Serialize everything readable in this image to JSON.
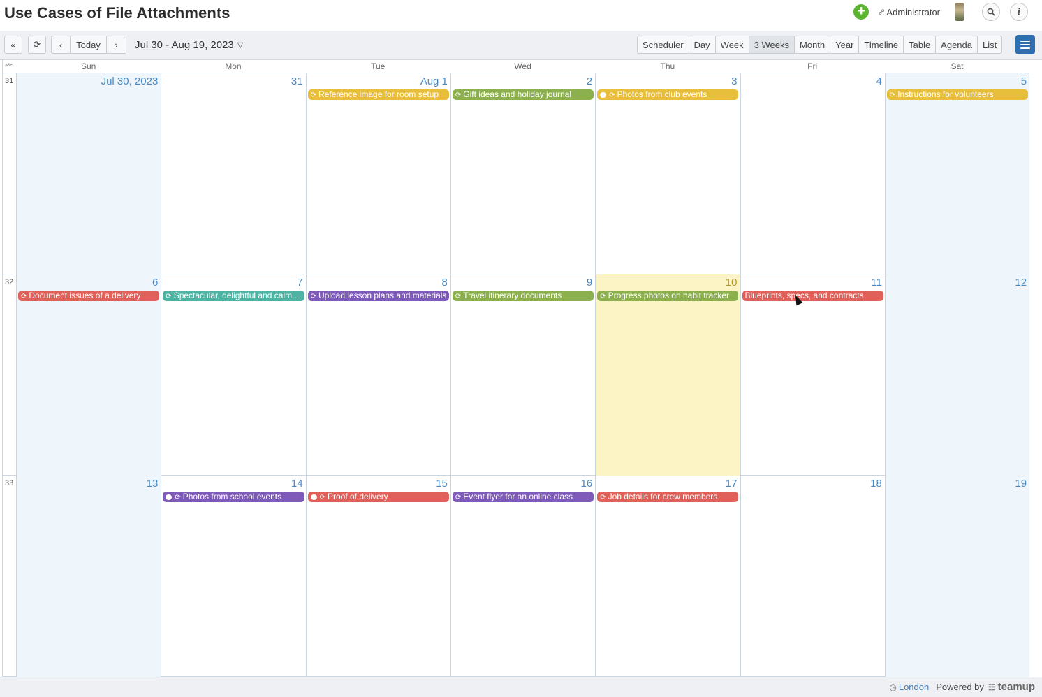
{
  "header": {
    "title": "Use Cases of File Attachments",
    "user": "Administrator",
    "icons": [
      "add-icon",
      "link-icon",
      "search-icon",
      "info-icon"
    ]
  },
  "toolbar": {
    "today_label": "Today",
    "date_range": "Jul 30 - Aug 19, 2023",
    "views": [
      "Scheduler",
      "Day",
      "Week",
      "3 Weeks",
      "Month",
      "Year",
      "Timeline",
      "Table",
      "Agenda",
      "List"
    ],
    "active_view": "3 Weeks"
  },
  "calendar": {
    "weekdays": [
      "Sun",
      "Mon",
      "Tue",
      "Wed",
      "Thu",
      "Fri",
      "Sat"
    ],
    "weeks": [
      {
        "number": "31",
        "days": [
          {
            "label": "Jul 30, 2023",
            "event": null
          },
          {
            "label": "31",
            "event": null
          },
          {
            "label": "Aug 1",
            "event": {
              "title": "Reference image for room setup",
              "color": "#e8bf3a",
              "recurring": true,
              "comment": false
            }
          },
          {
            "label": "2",
            "event": {
              "title": "Gift ideas and holiday journal",
              "color": "#8db04e",
              "recurring": true,
              "comment": false
            }
          },
          {
            "label": "3",
            "event": {
              "title": "Photos from club events",
              "color": "#e8bf3a",
              "recurring": true,
              "comment": true
            }
          },
          {
            "label": "4",
            "event": null
          },
          {
            "label": "5",
            "event": {
              "title": "Instructions for volunteers",
              "color": "#e8bf3a",
              "recurring": true,
              "comment": false
            }
          }
        ]
      },
      {
        "number": "32",
        "days": [
          {
            "label": "6",
            "event": {
              "title": "Document issues of a delivery",
              "color": "#e0615a",
              "recurring": true,
              "comment": false
            }
          },
          {
            "label": "7",
            "event": {
              "title": "Spectacular, delightful and calm ...",
              "color": "#4fb3a3",
              "recurring": true,
              "comment": false
            }
          },
          {
            "label": "8",
            "event": {
              "title": "Upload lesson plans and materials",
              "color": "#7e5bb8",
              "recurring": true,
              "comment": false
            }
          },
          {
            "label": "9",
            "event": {
              "title": "Travel itinerary documents",
              "color": "#8db04e",
              "recurring": true,
              "comment": false
            }
          },
          {
            "label": "10",
            "event": {
              "title": "Progress photos on habit tracker",
              "color": "#8db04e",
              "recurring": true,
              "comment": false
            }
          },
          {
            "label": "11",
            "event": {
              "title": "Blueprints, specs, and contracts",
              "color": "#e0615a",
              "recurring": false,
              "comment": false
            }
          },
          {
            "label": "12",
            "event": null
          }
        ]
      },
      {
        "number": "33",
        "days": [
          {
            "label": "13",
            "event": null
          },
          {
            "label": "14",
            "event": {
              "title": "Photos from school events",
              "color": "#7e5bb8",
              "recurring": true,
              "comment": true
            }
          },
          {
            "label": "15",
            "event": {
              "title": "Proof of delivery",
              "color": "#e0615a",
              "recurring": true,
              "comment": true
            }
          },
          {
            "label": "16",
            "event": {
              "title": "Event flyer for an online class",
              "color": "#7e5bb8",
              "recurring": true,
              "comment": false
            }
          },
          {
            "label": "17",
            "event": {
              "title": "Job details for crew members",
              "color": "#e0615a",
              "recurring": true,
              "comment": false
            }
          },
          {
            "label": "18",
            "event": null
          },
          {
            "label": "19",
            "event": null
          }
        ]
      }
    ]
  },
  "footer": {
    "timezone": "London",
    "powered_by": "Powered by",
    "brand": "teamup"
  },
  "colors": {
    "weekend_bg": "#eef6fc",
    "today_bg": "#fcf4c5",
    "accent": "#2f6fb0"
  }
}
